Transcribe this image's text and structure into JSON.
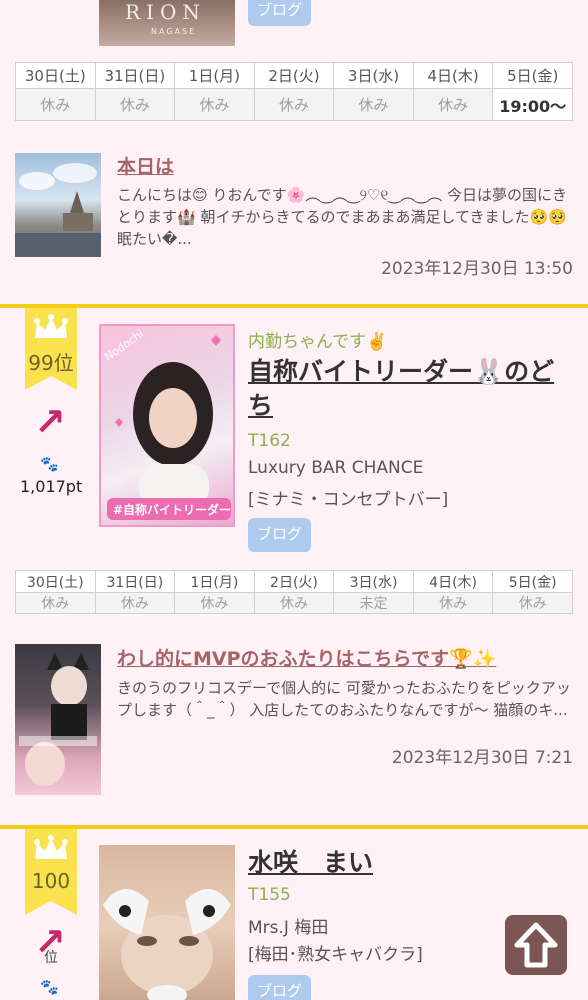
{
  "prev_card": {
    "photo_logo": "RION",
    "photo_logo_sub": "NAGASE",
    "blog_button": "ブログ",
    "schedule": [
      {
        "day": "30日(土)",
        "status": "休み",
        "type": "sat"
      },
      {
        "day": "31日(日)",
        "status": "休み",
        "type": "sun"
      },
      {
        "day": "1日(月)",
        "status": "休み",
        "type": "hol"
      },
      {
        "day": "2日(火)",
        "status": "休み",
        "type": "normal"
      },
      {
        "day": "3日(水)",
        "status": "休み",
        "type": "normal"
      },
      {
        "day": "4日(木)",
        "status": "休み",
        "type": "normal"
      },
      {
        "day": "5日(金)",
        "status": "19:00〜",
        "type": "normal",
        "working": true
      }
    ],
    "blog": {
      "title": "本日は",
      "excerpt": "こんにちは😊 りおんです🌸︵‿︵‿୨♡୧‿︵‿︵ 今日は夢の国にきとります🏰 朝イチからきてるのでまあまあ満足してきました🥺🥺 眠たい�...",
      "date": "2023年12月30日 13:50"
    }
  },
  "card_99": {
    "rank": "99位",
    "trend_icon": "arrow-up-right-icon",
    "points": "1,017pt",
    "photo_caption_top": "Nodochi",
    "photo_caption_bottom": "#自称バイトリーダー",
    "catchphrase": "内勤ちゃんです✌️",
    "name": "自称バイトリーダー🐰のどち",
    "height": "T162",
    "shop": "Luxury BAR CHANCE",
    "area": "[ミナミ・コンセプトバー]",
    "blog_button": "ブログ",
    "schedule": [
      {
        "day": "30日(土)",
        "status": "休み",
        "type": "sat"
      },
      {
        "day": "31日(日)",
        "status": "休み",
        "type": "sun"
      },
      {
        "day": "1日(月)",
        "status": "休み",
        "type": "hol"
      },
      {
        "day": "2日(火)",
        "status": "休み",
        "type": "normal"
      },
      {
        "day": "3日(水)",
        "status": "未定",
        "type": "normal"
      },
      {
        "day": "4日(木)",
        "status": "休み",
        "type": "normal"
      },
      {
        "day": "5日(金)",
        "status": "休み",
        "type": "normal"
      }
    ],
    "blog": {
      "title": "わし的にMVPのおふたりはこちらです🏆✨",
      "excerpt": "きのうのフリコスデーで個人的に 可愛かったおふたりをピックアップします（＾_＾） 入店したてのおふたりなんですが〜 猫顔のキ...",
      "date": "2023年12月30日 7:21"
    }
  },
  "card_100": {
    "rank": "100",
    "name": "水咲　まい",
    "height": "T155",
    "shop": "Mrs.J 梅田",
    "area": "[梅田･熟女キャバクラ]",
    "blog_button": "ブログ",
    "rank_suffix": "位"
  },
  "scroll_top_icon": "arrow-up-icon",
  "colors": {
    "background": "#fff1f5",
    "accent_yellow": "#f3cd16",
    "blog_title": "#a66468",
    "catch_green": "#8ab04e",
    "trend_arrow": "#c22a6c",
    "scroll_button": "#7c5555"
  }
}
